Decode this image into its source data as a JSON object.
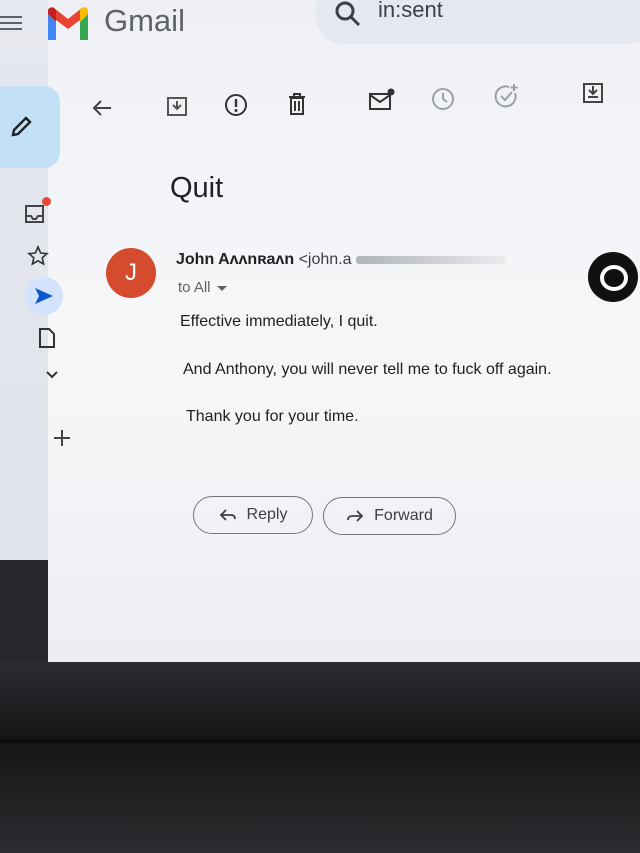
{
  "app": {
    "name": "Gmail"
  },
  "search": {
    "query": "in:sent"
  },
  "toolbar": {
    "icons": [
      "back-icon",
      "archive-icon",
      "report-spam-icon",
      "delete-icon",
      "mark-unread-icon",
      "snooze-icon",
      "add-to-tasks-icon",
      "move-to-icon"
    ]
  },
  "nav": {
    "icons": [
      "compose-pencil-icon",
      "inbox-icon",
      "starred-icon",
      "sent-icon",
      "drafts-icon",
      "more-chevron-icon",
      "new-label-plus-icon"
    ],
    "active": "sent-icon"
  },
  "message": {
    "subject": "Quit",
    "avatar_letter": "J",
    "sender_name": "John Aʌʌnʀaʌn",
    "sender_email": "<john.a",
    "recipients": "to All",
    "body": [
      "Effective immediately, I quit.",
      "And Anthony, you will never tell me to fuck off again.",
      "Thank you for your time."
    ]
  },
  "actions": {
    "reply": "Reply",
    "forward": "Forward"
  },
  "colors": {
    "avatar": "#d44b2d",
    "accent": "#c2e1f7",
    "badge": "#e5493a"
  }
}
